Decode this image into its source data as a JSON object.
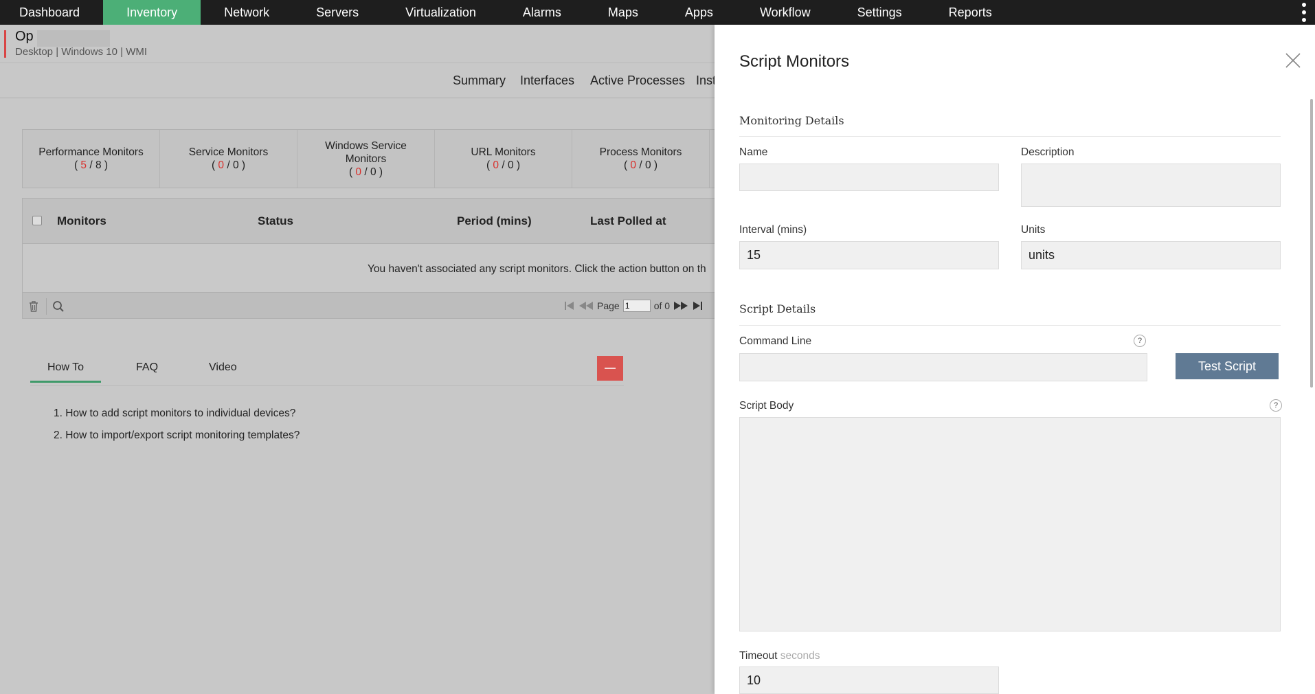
{
  "nav": {
    "items": [
      "Dashboard",
      "Inventory",
      "Network",
      "Servers",
      "Virtualization",
      "Alarms",
      "Maps",
      "Apps",
      "Workflow",
      "Settings",
      "Reports"
    ],
    "active": "Inventory"
  },
  "device": {
    "name": "Op",
    "meta": "Desktop | Windows 10  | WMI"
  },
  "subtabs": [
    "Summary",
    "Interfaces",
    "Active Processes",
    "Inst"
  ],
  "monitor_summary": [
    {
      "label": "Performance Monitors",
      "count_a": "5",
      "count_b": "8"
    },
    {
      "label": "Service Monitors",
      "count_a": "0",
      "count_b": "0"
    },
    {
      "label": "Windows Service Monitors",
      "count_a": "0",
      "count_b": "0"
    },
    {
      "label": "URL Monitors",
      "count_a": "0",
      "count_b": "0"
    },
    {
      "label": "Process Monitors",
      "count_a": "0",
      "count_b": "0"
    }
  ],
  "table": {
    "headers": [
      "Monitors",
      "Status",
      "Period (mins)",
      "Last Polled at"
    ],
    "empty_message": "You haven't associated any script monitors. Click the action button on th",
    "pager": {
      "page_label": "Page",
      "page_value": "1",
      "of_label": "of 0"
    }
  },
  "help": {
    "tabs": [
      "How To",
      "FAQ",
      "Video"
    ],
    "active_tab": "How To",
    "items": [
      "1. How to add script monitors to individual devices?",
      "2. How to import/export script monitoring templates?"
    ]
  },
  "drawer": {
    "title": "Script Monitors",
    "monitoring_details": {
      "section_title": "Monitoring Details",
      "name_label": "Name",
      "name_value": "",
      "description_label": "Description",
      "description_value": "",
      "interval_label": "Interval (mins)",
      "interval_value": "15",
      "units_label": "Units",
      "units_value": "units"
    },
    "script_details": {
      "section_title": "Script Details",
      "command_line_label": "Command Line",
      "command_line_value": "",
      "test_script_label": "Test Script",
      "script_body_label": "Script Body",
      "script_body_value": "",
      "timeout_label": "Timeout",
      "timeout_unit": "seconds",
      "timeout_value": "10",
      "help_glyph": "?"
    }
  },
  "colors": {
    "nav_bg": "#1e1e1e",
    "nav_active": "#4caf77",
    "accent_red": "#d94545",
    "test_button": "#607a94"
  }
}
